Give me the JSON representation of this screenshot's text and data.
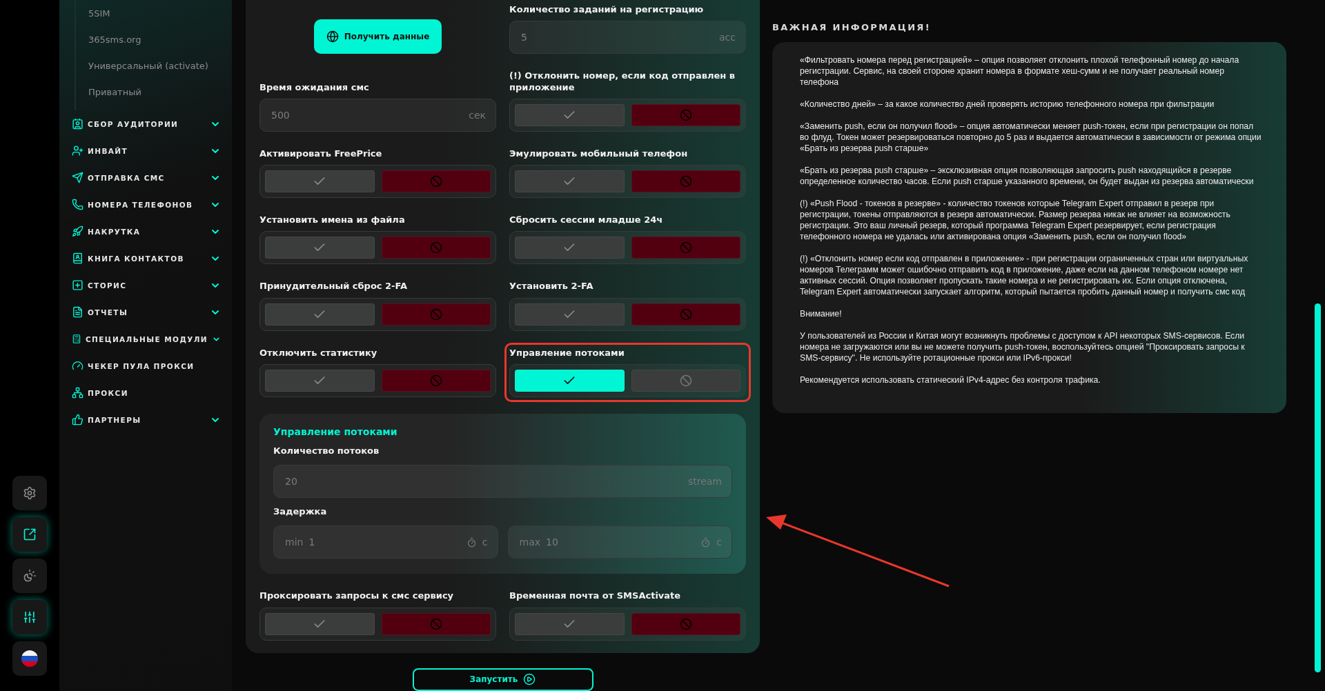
{
  "rail": [
    {
      "active": false
    },
    {
      "active": true
    },
    {
      "active": false
    },
    {
      "active": true
    },
    {
      "active": false
    }
  ],
  "sidebar": {
    "sub_items": [
      "5SIM",
      "365sms.org",
      "Универсальный (activate)",
      "Приватный"
    ],
    "items": [
      {
        "label": "СБОР АУДИТОРИИ",
        "expandable": true
      },
      {
        "label": "ИНВАЙТ",
        "expandable": true
      },
      {
        "label": "ОТПРАВКА СМС",
        "expandable": true
      },
      {
        "label": "НОМЕРА ТЕЛЕФОНОВ",
        "expandable": true
      },
      {
        "label": "НАКРУТКА",
        "expandable": true
      },
      {
        "label": "КНИГА КОНТАКТОВ",
        "expandable": true
      },
      {
        "label": "СТОРИС",
        "expandable": true
      },
      {
        "label": "ОТЧЕТЫ",
        "expandable": true
      },
      {
        "label": "СПЕЦИАЛЬНЫЕ МОДУЛИ",
        "expandable": true
      },
      {
        "label": "ЧЕКЕР ПУЛА ПРОКСИ",
        "expandable": false
      },
      {
        "label": "ПРОКСИ",
        "expandable": false
      },
      {
        "label": "ПАРТНЕРЫ",
        "expandable": true
      }
    ]
  },
  "form": {
    "rows": [
      [
        {
          "kind": "button",
          "label": "Получить данные"
        },
        {
          "kind": "field",
          "label": "Количество заданий на регистрацию",
          "value": "5",
          "unit": "acc"
        }
      ],
      [
        {
          "kind": "field",
          "label": "Время ожидания смс",
          "value": "500",
          "unit": "сек"
        },
        {
          "kind": "toggle",
          "label": "(!) Отклонить номер, если код отправлен в приложение",
          "on": false
        }
      ],
      [
        {
          "kind": "toggle",
          "label": "Активировать FreePrice",
          "on": false
        },
        {
          "kind": "toggle",
          "label": "Эмулировать мобильный телефон",
          "on": false
        }
      ],
      [
        {
          "kind": "toggle",
          "label": "Установить имена из файла",
          "on": false
        },
        {
          "kind": "toggle",
          "label": "Сбросить сессии младше 24ч",
          "on": false
        }
      ],
      [
        {
          "kind": "toggle",
          "label": "Принудительный сброс 2-FA",
          "on": false
        },
        {
          "kind": "toggle",
          "label": "Установить 2-FA",
          "on": false
        }
      ],
      [
        {
          "kind": "toggle",
          "label": "Отключить статистику",
          "on": false
        },
        {
          "kind": "toggle",
          "label": "Управление потоками",
          "on": true,
          "highlighted": true
        }
      ]
    ],
    "threads_panel": {
      "title": "Управление потоками",
      "threads": {
        "label": "Количество потоков",
        "value": "20",
        "unit": "stream"
      },
      "delay": {
        "label": "Задержка",
        "min": {
          "prefix": "min",
          "value": "1",
          "unit": "с"
        },
        "max": {
          "prefix": "max",
          "value": "10",
          "unit": "с"
        }
      }
    },
    "bottom_rows": [
      [
        {
          "kind": "toggle",
          "label": "Проксировать запросы к смс сервису",
          "on": false
        },
        {
          "kind": "toggle",
          "label": "Временная почта от SMSActivate",
          "on": false
        }
      ]
    ],
    "run_button": "Запустить"
  },
  "info": {
    "title": "ВАЖНАЯ ИНФОРМАЦИЯ!",
    "paragraphs": [
      "«Фильтровать номера перед регистрацией» – опция позволяет отклонить плохой телефонный номер до начала регистрации. Сервис, на своей стороне хранит номера в формате хеш-сумм и не получает реальный номер телефона",
      "«Количество дней» – за какое количество дней проверять историю телефонного номера при фильтрации",
      "«Заменить push, если он получил flood» – опция автоматически меняет push-токен, если при регистрации он попал во флуд. Токен может резервироваться повторно до 5 раз и выдается автоматически в зависимости от режима опции «Брать из резерва push старше»",
      "«Брать из резерва push старше» – эксклюзивная опция позволяющая запросить push находящийся в резерве определенное количество часов. Если push старше указанного времени, он будет выдан из резерва автоматически",
      "(!) «Push Flood - токенов в резерве» - количество токенов которые Telegram Expert отправил в резерв при регистрации, токены отправляются в резерв автоматически. Размер резерва никак не влияет на возможность регистрации. Это ваш личный резерв, который программа Telegram Expert резервирует, если регистрация телефонного номера не удалась или активирована опция «Заменить push, если он получил flood»",
      "(!) «Отклонить номер если код отправлен в приложение» - при регистрации ограниченных стран или виртуальных номеров Телеграмм может ошибочно отправить код в приложение, даже если на данном телефоном номере нет активных сессий. Опция позволяет пропускать такие номера и не регистрировать их. Если опция отключена, Telegram Expert автоматически запускает алгоритм, который пытается пробить данный номер и получить смс код",
      "Внимание!",
      "У пользователей из России и Китая могут возникнуть проблемы с доступом к API некоторых SMS-сервисов. Если номера не загружаются или вы не можете получить push-токен, воспользуйтесь опцией \"Проксировать запросы к SMS-сервису\". Не используйте ротационные прокси или IPv6-прокси!",
      "Рекомендуется использовать статический IPv4-адрес без контроля трафика."
    ]
  },
  "annotation": {
    "arrow": true
  }
}
